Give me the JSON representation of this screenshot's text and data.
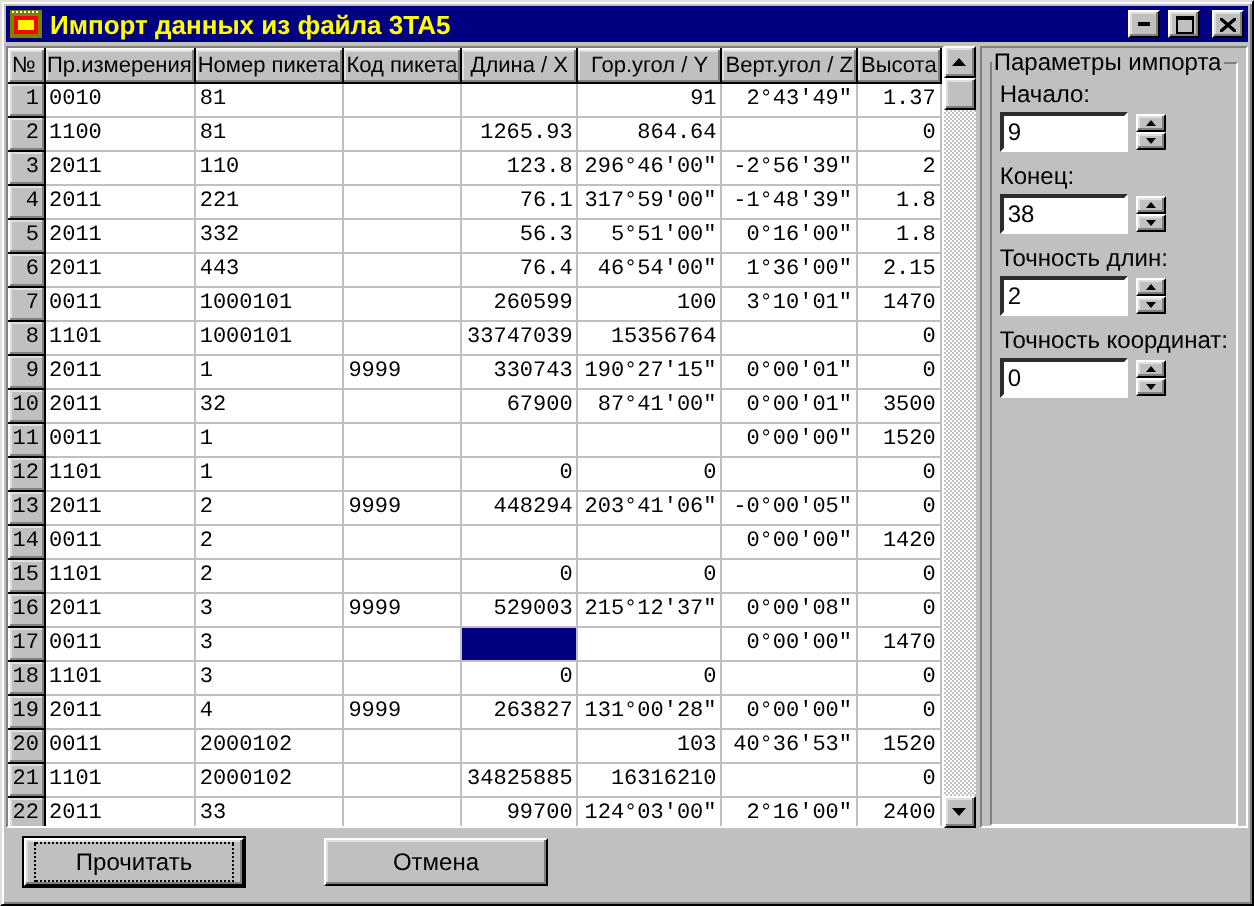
{
  "window": {
    "title": "Импорт данных из файла 3TA5"
  },
  "table": {
    "number_heading": "№",
    "columns": [
      "Пр.измерения",
      "Номер пикета",
      "Код пикета",
      "Длина / X",
      "Гор.угол / Y",
      "Верт.угол / Z",
      "Высота"
    ],
    "rows": [
      {
        "number": "1",
        "selected": false,
        "cells": [
          "0010",
          "81",
          null,
          null,
          "91",
          "2°43'49\"",
          "1.37"
        ]
      },
      {
        "number": "2",
        "selected": false,
        "cells": [
          "1100",
          "81",
          null,
          "1265.93",
          "864.64",
          null,
          "0"
        ]
      },
      {
        "number": "3",
        "selected": false,
        "cells": [
          "2011",
          "110",
          null,
          "123.8",
          "296°46'00\"",
          "-2°56'39\"",
          "2"
        ]
      },
      {
        "number": "4",
        "selected": false,
        "cells": [
          "2011",
          "221",
          null,
          "76.1",
          "317°59'00\"",
          "-1°48'39\"",
          "1.8"
        ]
      },
      {
        "number": "5",
        "selected": false,
        "cells": [
          "2011",
          "332",
          null,
          "56.3",
          "5°51'00\"",
          "0°16'00\"",
          "1.8"
        ]
      },
      {
        "number": "6",
        "selected": false,
        "cells": [
          "2011",
          "443",
          null,
          "76.4",
          "46°54'00\"",
          "1°36'00\"",
          "2.15"
        ]
      },
      {
        "number": "7",
        "selected": false,
        "cells": [
          "0011",
          "1000101",
          null,
          "260599",
          "100",
          "3°10'01\"",
          "1470"
        ]
      },
      {
        "number": "8",
        "selected": false,
        "cells": [
          "1101",
          "1000101",
          null,
          "33747039",
          "15356764",
          null,
          "0"
        ]
      },
      {
        "number": "9",
        "selected": false,
        "cells": [
          "2011",
          "1",
          "9999",
          "330743",
          "190°27'15\"",
          "0°00'01\"",
          "0"
        ]
      },
      {
        "number": "10",
        "selected": false,
        "cells": [
          "2011",
          "32",
          null,
          "67900",
          "87°41'00\"",
          "0°00'01\"",
          "3500"
        ]
      },
      {
        "number": "11",
        "selected": false,
        "cells": [
          "0011",
          "1",
          null,
          null,
          null,
          "0°00'00\"",
          "1520"
        ]
      },
      {
        "number": "12",
        "selected": false,
        "cells": [
          "1101",
          "1",
          null,
          "0",
          "0",
          null,
          "0"
        ]
      },
      {
        "number": "13",
        "selected": false,
        "cells": [
          "2011",
          "2",
          "9999",
          "448294",
          "203°41'06\"",
          "-0°00'05\"",
          "0"
        ]
      },
      {
        "number": "14",
        "selected": false,
        "cells": [
          "0011",
          "2",
          null,
          null,
          null,
          "0°00'00\"",
          "1420"
        ]
      },
      {
        "number": "15",
        "selected": false,
        "cells": [
          "1101",
          "2",
          null,
          "0",
          "0",
          null,
          "0"
        ]
      },
      {
        "number": "16",
        "selected": false,
        "cells": [
          "2011",
          "3",
          "9999",
          "529003",
          "215°12'37\"",
          "0°00'08\"",
          "0"
        ]
      },
      {
        "number": "17",
        "selected": false,
        "cells": [
          "0011",
          "3",
          null,
          {
            "selected": true
          },
          null,
          "0°00'00\"",
          "1470"
        ]
      },
      {
        "number": "18",
        "selected": false,
        "cells": [
          "1101",
          "3",
          null,
          "0",
          "0",
          null,
          "0"
        ]
      },
      {
        "number": "19",
        "selected": false,
        "cells": [
          "2011",
          "4",
          "9999",
          "263827",
          "131°00'28\"",
          "0°00'00\"",
          "0"
        ]
      },
      {
        "number": "20",
        "selected": false,
        "cells": [
          "0011",
          "2000102",
          null,
          null,
          "103",
          "40°36'53\"",
          "1520"
        ]
      },
      {
        "number": "21",
        "selected": false,
        "cells": [
          "1101",
          "2000102",
          null,
          "34825885",
          "16316210",
          null,
          "0"
        ]
      },
      {
        "number": "22",
        "selected": false,
        "cells": [
          "2011",
          "33",
          null,
          "99700",
          "124°03'00\"",
          "2°16'00\"",
          "2400"
        ]
      }
    ]
  },
  "import_parameters": {
    "title": "Параметры импорта",
    "fields": [
      {
        "label": "Начало:",
        "value": "9"
      },
      {
        "label": "Конец:",
        "value": "38"
      },
      {
        "label": "Точность длин:",
        "value": "2"
      },
      {
        "label": "Точность координат:",
        "value": "0"
      }
    ]
  },
  "buttons": [
    {
      "label": "Прочитать",
      "default": true
    },
    {
      "label": "Отмена",
      "default": false
    }
  ]
}
